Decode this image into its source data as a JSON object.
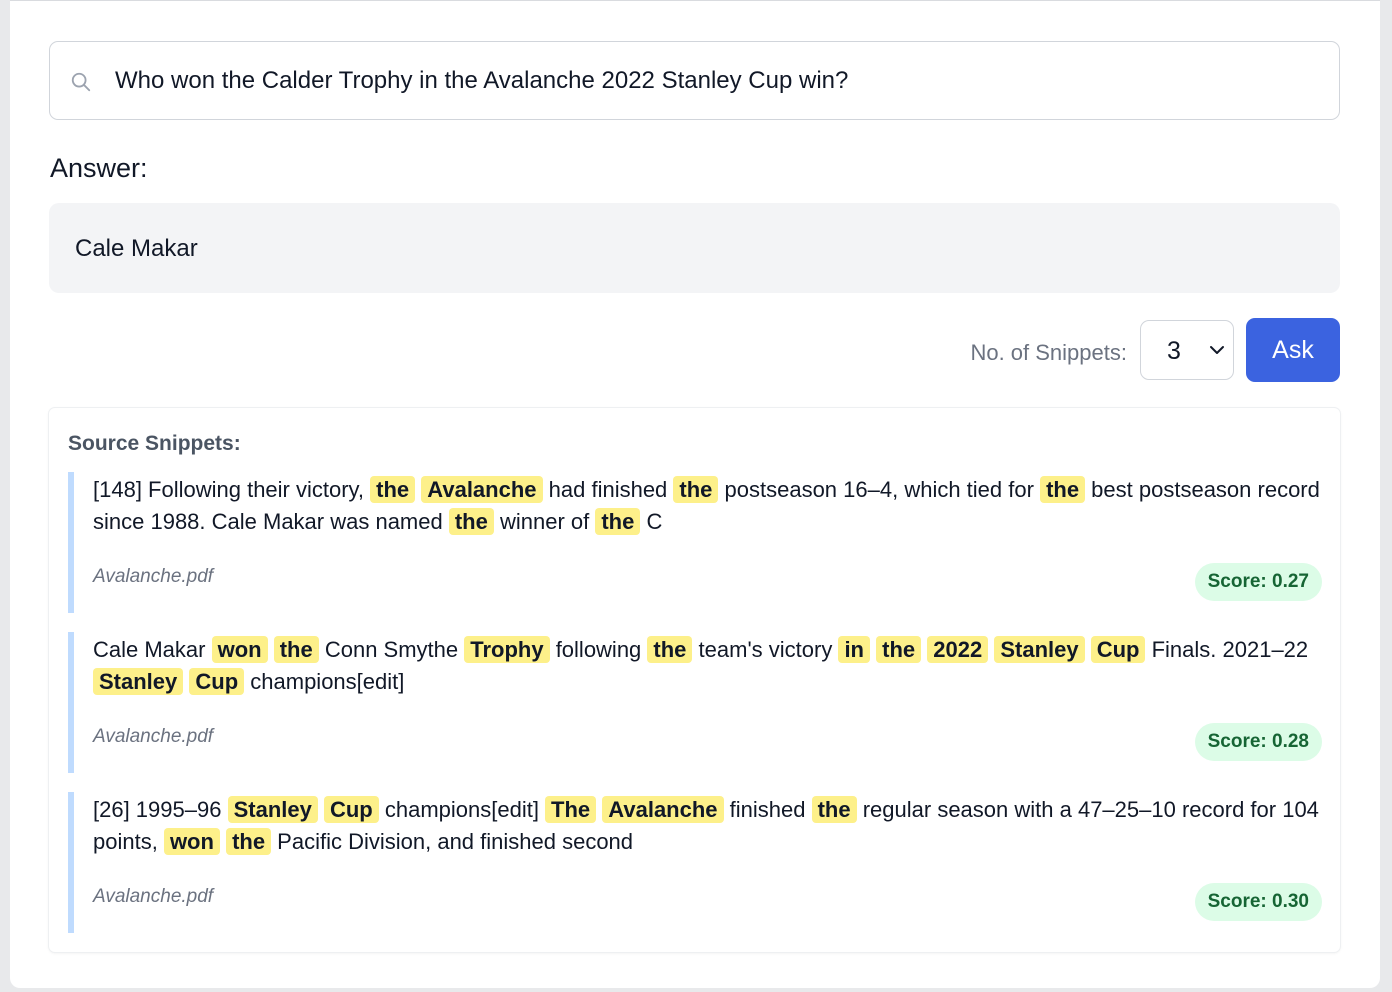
{
  "search": {
    "icon": "search-icon",
    "query": "Who won the Calder Trophy in the Avalanche 2022 Stanley Cup win?"
  },
  "answer": {
    "heading": "Answer:",
    "text": "Cale Makar"
  },
  "controls": {
    "snippets_label": "No. of Snippets:",
    "snippets_value": "3",
    "ask_label": "Ask"
  },
  "sources": {
    "title": "Source Snippets:",
    "snippets": [
      {
        "segments": [
          {
            "t": "[148] Following their victory, "
          },
          {
            "t": "the",
            "h": 1
          },
          {
            "t": " "
          },
          {
            "t": "Avalanche",
            "h": 1
          },
          {
            "t": " had finished "
          },
          {
            "t": "the",
            "h": 1
          },
          {
            "t": " postseason 16–4, which tied for "
          },
          {
            "t": "the",
            "h": 1
          },
          {
            "t": " best postseason record since 1988. Cale Makar was named "
          },
          {
            "t": "the",
            "h": 1
          },
          {
            "t": " winner of "
          },
          {
            "t": "the",
            "h": 1
          },
          {
            "t": " C"
          }
        ],
        "source": "Avalanche.pdf",
        "score": "Score: 0.27"
      },
      {
        "segments": [
          {
            "t": "Cale Makar "
          },
          {
            "t": "won",
            "h": 1
          },
          {
            "t": " "
          },
          {
            "t": "the",
            "h": 1
          },
          {
            "t": " Conn Smythe "
          },
          {
            "t": "Trophy",
            "h": 1
          },
          {
            "t": " following "
          },
          {
            "t": "the",
            "h": 1
          },
          {
            "t": " team's victory "
          },
          {
            "t": "in",
            "h": 1
          },
          {
            "t": " "
          },
          {
            "t": "the",
            "h": 1
          },
          {
            "t": " "
          },
          {
            "t": "2022",
            "h": 1
          },
          {
            "t": " "
          },
          {
            "t": "Stanley",
            "h": 1
          },
          {
            "t": " "
          },
          {
            "t": "Cup",
            "h": 1
          },
          {
            "t": " Finals. 2021–22 "
          },
          {
            "t": "Stanley",
            "h": 1
          },
          {
            "t": " "
          },
          {
            "t": "Cup",
            "h": 1
          },
          {
            "t": " champions[edit]"
          }
        ],
        "source": "Avalanche.pdf",
        "score": "Score: 0.28"
      },
      {
        "segments": [
          {
            "t": "[26] 1995–96 "
          },
          {
            "t": "Stanley",
            "h": 1
          },
          {
            "t": " "
          },
          {
            "t": "Cup",
            "h": 1
          },
          {
            "t": " champions[edit] "
          },
          {
            "t": "The",
            "h": 1
          },
          {
            "t": " "
          },
          {
            "t": "Avalanche",
            "h": 1
          },
          {
            "t": " finished "
          },
          {
            "t": "the",
            "h": 1
          },
          {
            "t": " regular season with a 47–25–10 record for 104 points, "
          },
          {
            "t": "won",
            "h": 1
          },
          {
            "t": " "
          },
          {
            "t": "the",
            "h": 1
          },
          {
            "t": " Pacific Division, and finished second"
          }
        ],
        "source": "Avalanche.pdf",
        "score": "Score: 0.30"
      }
    ]
  },
  "colors": {
    "accent": "#3b63e0",
    "highlight": "#fdf08a",
    "snippet_border": "#bfdbfe",
    "score_bg": "#dcfce7",
    "score_text": "#166534"
  }
}
